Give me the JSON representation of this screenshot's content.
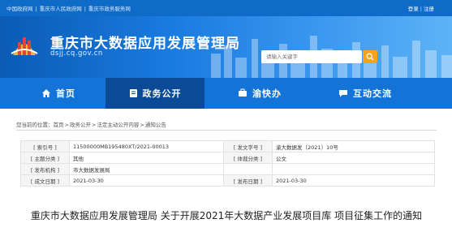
{
  "topbar": {
    "links": [
      "中国政府网",
      "重庆市人民政府网",
      "重庆市政务服务网"
    ],
    "separator": "|",
    "login": "登录",
    "register": "注册"
  },
  "header": {
    "title": "重庆市大数据应用发展管理局",
    "domain": "dsjj.cq.gov.cn",
    "search_placeholder": "请输入关键字"
  },
  "nav": {
    "items": [
      {
        "label": "首页",
        "icon": "home-icon"
      },
      {
        "label": "政务公开",
        "icon": "document-icon",
        "active": true
      },
      {
        "label": "渝快办",
        "icon": "quick-service-icon"
      },
      {
        "label": "互动交流",
        "icon": "chat-icon"
      }
    ]
  },
  "breadcrumb": {
    "prefix": "您当前的位置：",
    "items": [
      "首页",
      "政务公开",
      "法定主动公开内容",
      "通知公告"
    ],
    "separator": ">"
  },
  "meta": {
    "index_key": "[ 索引号 ]",
    "index_value": "11500000MB195480XT/2021-00013",
    "doc_no_key": "[ 发文字号 ]",
    "doc_no_value": "渝大数据发〔2021〕10号",
    "subject_key": "[ 主题分类 ]",
    "subject_value": "其他",
    "genre_key": "[ 体裁分类 ]",
    "genre_value": "公文",
    "issuer_key": "[ 发布机构 ]",
    "issuer_value": "市大数据发展局",
    "created_key": "[ 成文日期 ]",
    "created_value": "2021-03-30",
    "published_key": "[ 发布日期 ]",
    "published_value": "2021-03-30"
  },
  "article": {
    "title": "重庆市大数据应用发展管理局 关于开展2021年大数据产业发展项目库 项目征集工作的通知"
  },
  "colors": {
    "topbar": "#0e6bc7",
    "nav": "#1473d6",
    "nav_active": "#0b4a96",
    "search_button": "#f7a21b"
  }
}
